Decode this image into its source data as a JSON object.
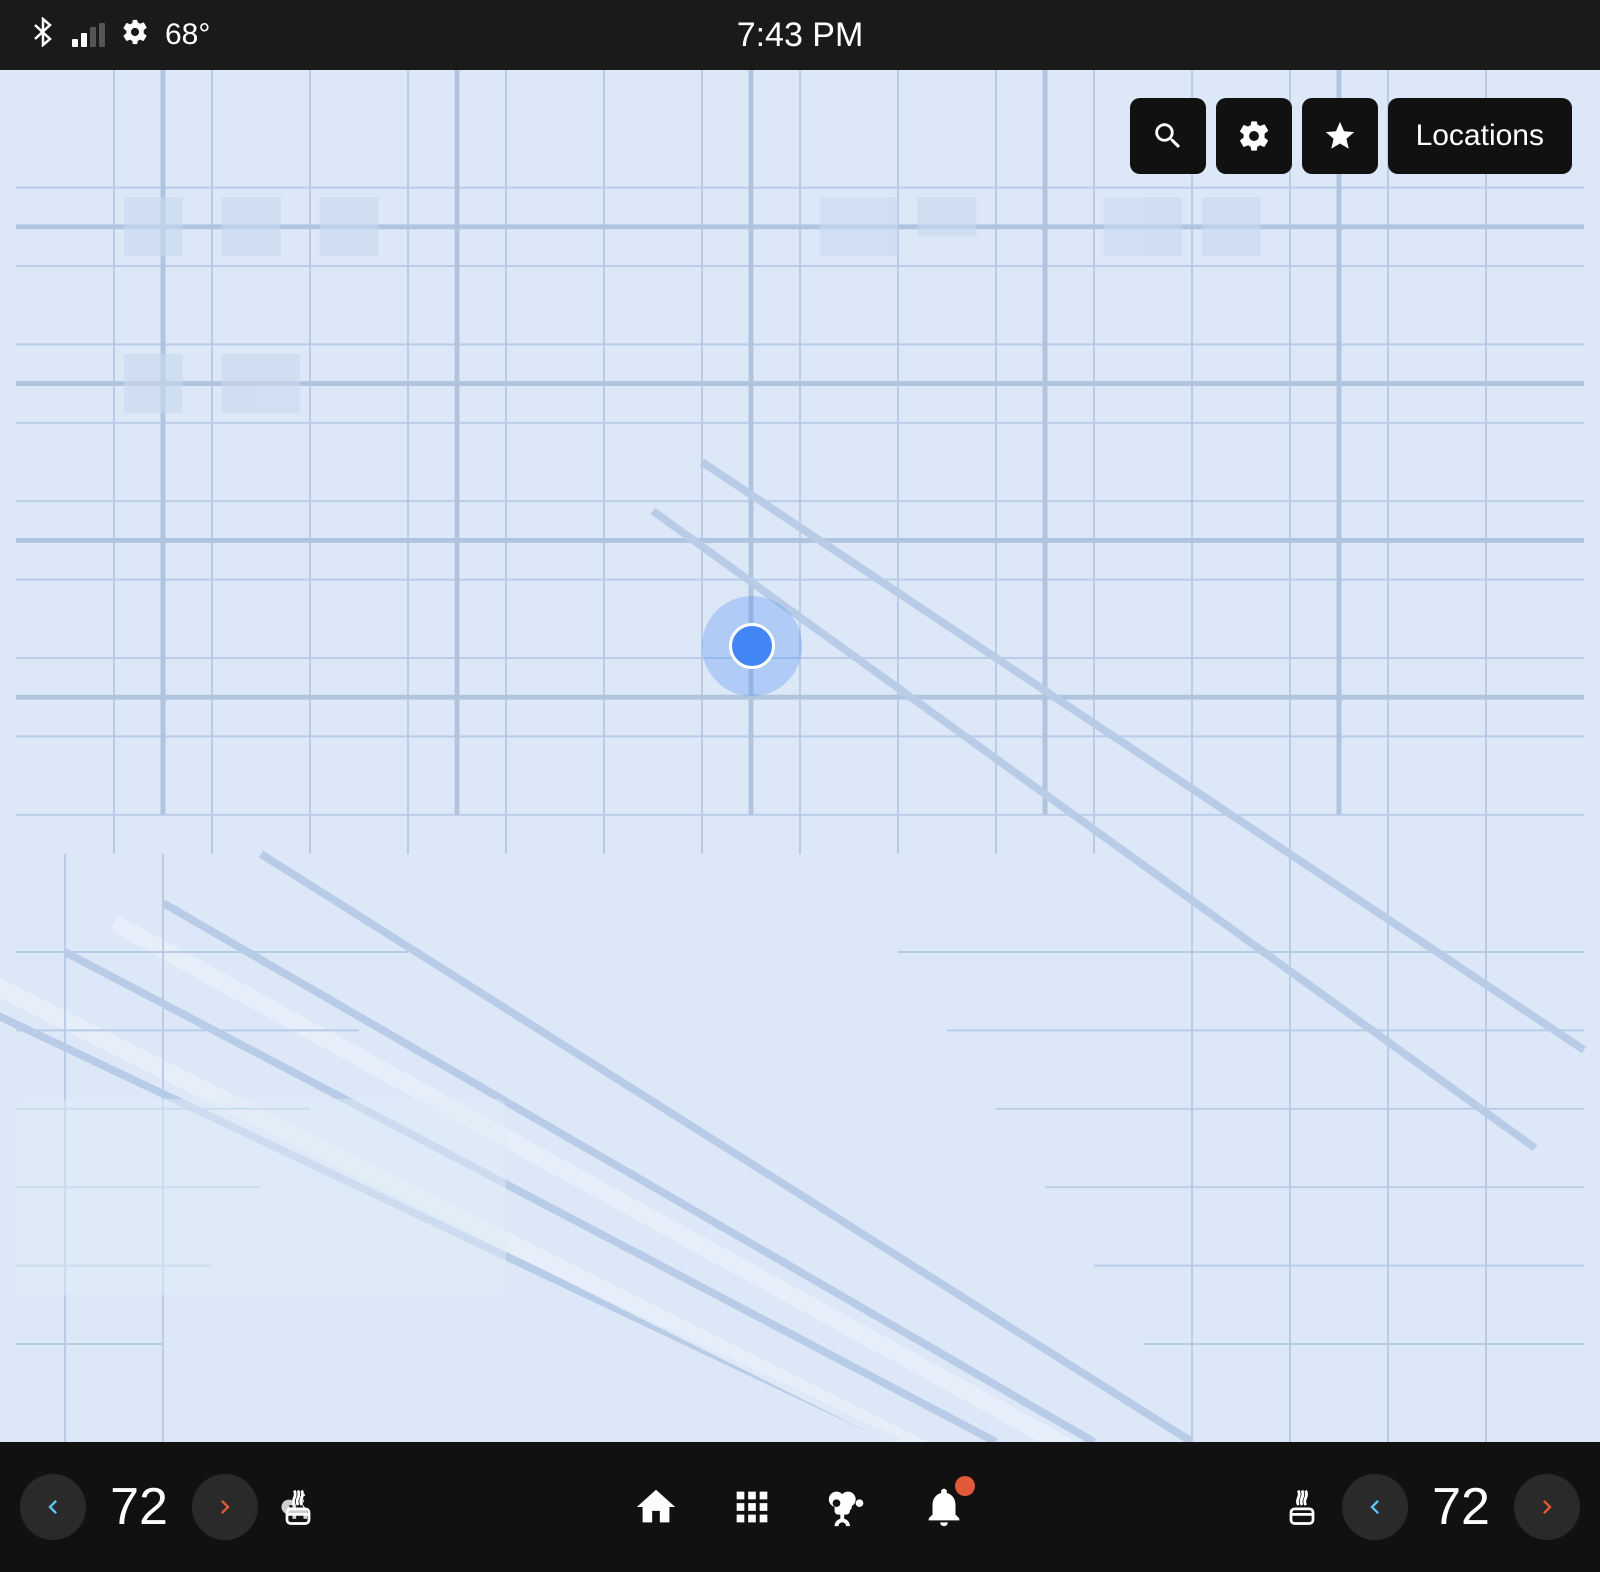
{
  "statusBar": {
    "bluetooth_label": "BT",
    "signal_label": "Signal",
    "settings_label": "Settings",
    "temperature": "68°",
    "time": "7:43 PM"
  },
  "mapToolbar": {
    "search_label": "🔍",
    "settings_label": "⚙",
    "favorites_label": "★",
    "locations_label": "Locations"
  },
  "bottomBar": {
    "left_temp": "72",
    "right_temp": "72",
    "nav_left_label": "‹",
    "nav_right_label": "›"
  },
  "icons": {
    "bluetooth": "bluetooth-icon",
    "signal": "signal-icon",
    "settings": "settings-icon",
    "search": "search-icon",
    "gear": "gear-icon",
    "star": "star-icon",
    "home": "home-icon",
    "grid": "grid-icon",
    "fan": "fan-icon",
    "bell": "bell-icon",
    "heat_left": "heat-left-icon",
    "heat_right": "heat-right-icon",
    "left_chevron": "left-chevron-icon",
    "right_chevron": "right-chevron-icon"
  }
}
